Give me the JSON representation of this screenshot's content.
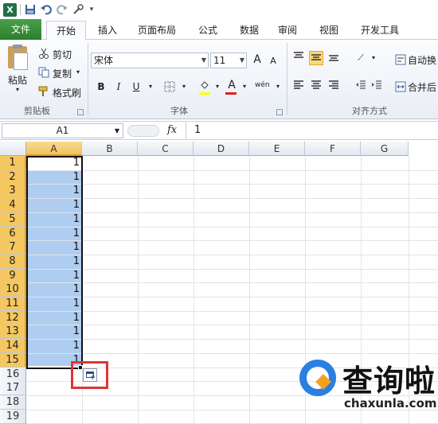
{
  "qat": {
    "icons": [
      "excel-logo-icon",
      "save-icon",
      "undo-icon",
      "redo-icon",
      "tools-icon",
      "customize-icon"
    ],
    "excel_letter": "X"
  },
  "tabs": [
    "文件",
    "开始",
    "插入",
    "页面布局",
    "公式",
    "数据",
    "审阅",
    "视图",
    "开发工具"
  ],
  "ribbon": {
    "clipboard": {
      "paste": "粘贴",
      "cut": "剪切",
      "copy": "复制",
      "format_painter": "格式刷",
      "label": "剪贴板"
    },
    "font": {
      "name": "宋体",
      "size": "11",
      "grow": "A",
      "shrink": "A",
      "bold": "B",
      "italic": "I",
      "underline": "U",
      "label": "字体",
      "fill_color": "#ffff00",
      "font_color": "#e02020"
    },
    "alignment": {
      "wrap": "自动换",
      "merge": "合并后",
      "label": "对齐方式"
    }
  },
  "formula_bar": {
    "name_box": "A1",
    "fx": "fx",
    "value": "1"
  },
  "grid": {
    "columns": [
      "A",
      "B",
      "C",
      "D",
      "E",
      "F",
      "G"
    ],
    "rows": [
      "1",
      "2",
      "3",
      "4",
      "5",
      "6",
      "7",
      "8",
      "9",
      "10",
      "11",
      "12",
      "13",
      "14",
      "15",
      "16",
      "17",
      "18",
      "19"
    ],
    "selected_column": "A",
    "selected_rows": "1-15",
    "cells_A": [
      "1",
      "1",
      "1",
      "1",
      "1",
      "1",
      "1",
      "1",
      "1",
      "1",
      "1",
      "1",
      "1",
      "1",
      "1"
    ]
  },
  "watermark": {
    "title": "查询啦",
    "url": "chaxunla.com"
  },
  "colors": {
    "file_tab": "#2c7e2c",
    "selection": "#aecdf0",
    "header_selected": "#f4c761",
    "highlight_box": "#e03434",
    "brand_blue": "#2a7fe0",
    "brand_orange": "#f6a11c"
  }
}
